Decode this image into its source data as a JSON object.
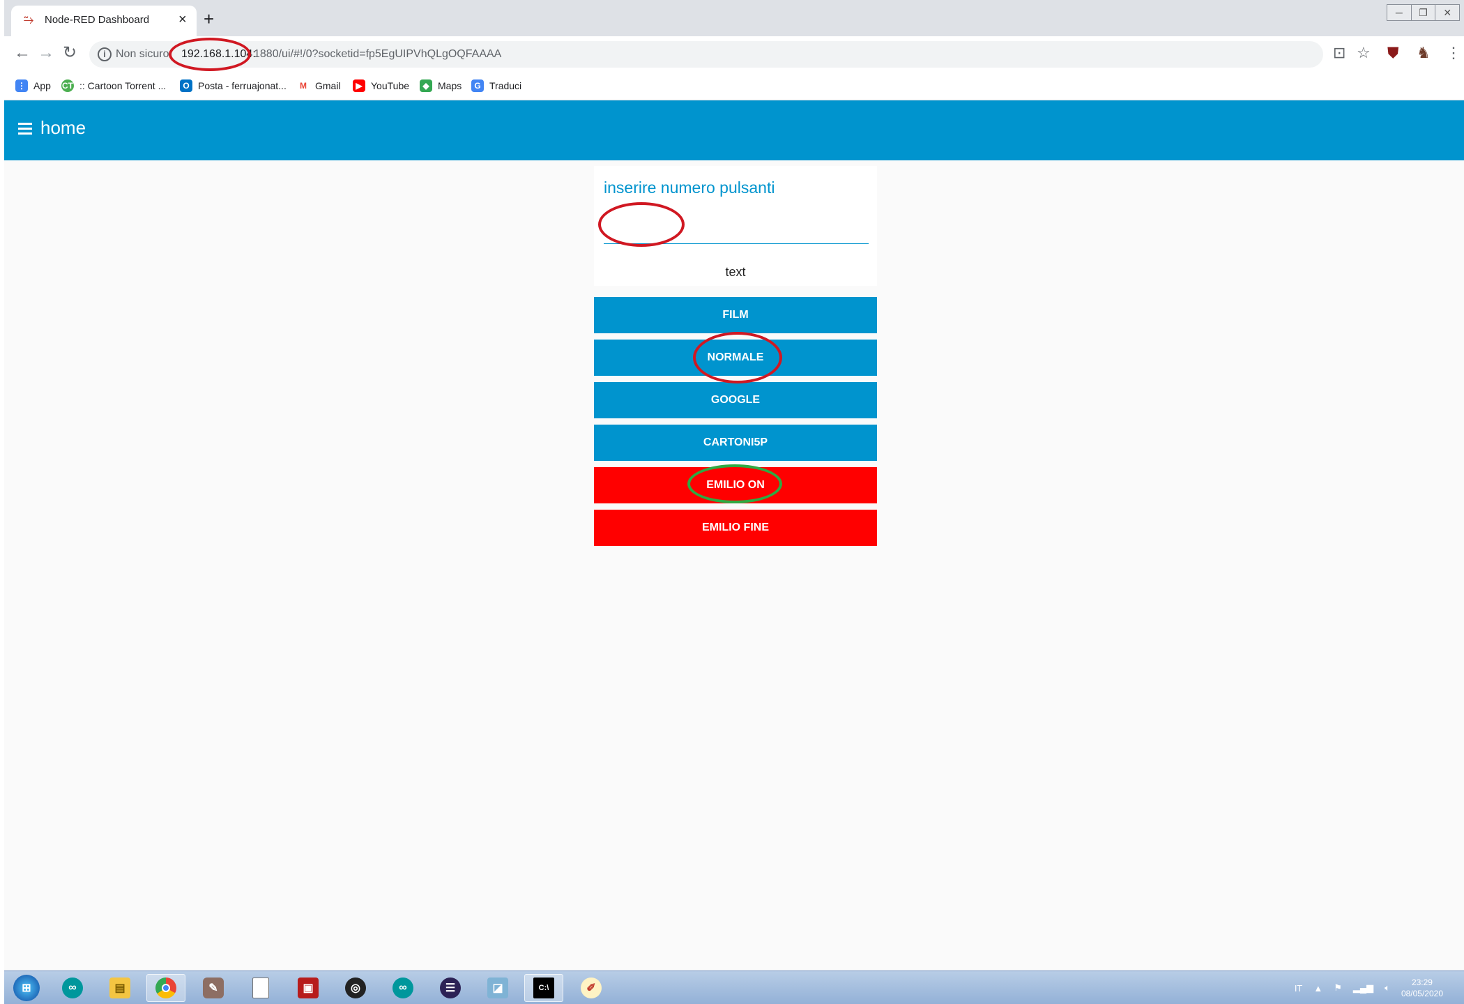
{
  "browser": {
    "tab_title": "Node-RED Dashboard",
    "tab_close": "×",
    "new_tab": "+",
    "security_label": "Non sicuro",
    "url_host": "192.168.1.104:",
    "url_rest": "1880/ui/#!/0?socketid=fp5EgUIPVhQLgOQFAAAA",
    "window_controls": [
      "─",
      "❐",
      "✕"
    ]
  },
  "bookmarks": [
    {
      "label": "App",
      "icon": "apps-grid-icon",
      "color": "#4285f4"
    },
    {
      "label": ":: Cartoon Torrent ...",
      "icon": "cartoon-torrent-icon",
      "color": "#4caf50"
    },
    {
      "label": "Posta - ferruajonat...",
      "icon": "outlook-icon",
      "color": "#0072c6"
    },
    {
      "label": "Gmail",
      "icon": "gmail-icon",
      "color": "#ea4335"
    },
    {
      "label": "YouTube",
      "icon": "youtube-icon",
      "color": "#ff0000"
    },
    {
      "label": "Maps",
      "icon": "maps-icon",
      "color": "#34a853"
    },
    {
      "label": "Traduci",
      "icon": "translate-icon",
      "color": "#4285f4"
    }
  ],
  "app": {
    "title": "home",
    "accent": "#0094ce"
  },
  "form": {
    "label": "inserire numero pulsanti",
    "input_value": "",
    "text_output": "text"
  },
  "buttons": [
    {
      "label": "FILM",
      "color": "#0094ce"
    },
    {
      "label": "NORMALE",
      "color": "#0094ce"
    },
    {
      "label": "GOOGLE",
      "color": "#0094ce"
    },
    {
      "label": "CARTONI5P",
      "color": "#0094ce"
    },
    {
      "label": "EMILIO ON",
      "color": "#ff0000"
    },
    {
      "label": "EMILIO FINE",
      "color": "#ff0000"
    }
  ],
  "annotations": {
    "red": "#d01822",
    "green": "#2eaa43"
  },
  "taskbar": {
    "language": "IT",
    "time": "23:29",
    "date": "08/05/2020",
    "apps": [
      "start-orb-icon",
      "arduino-icon",
      "file-explorer-icon",
      "chrome-icon",
      "gimp-icon",
      "blank-document-icon",
      "node-red-icon",
      "obs-icon",
      "arduino-icon-2",
      "eclipse-icon",
      "notepad-icon",
      "command-prompt-icon",
      "paint-icon"
    ]
  }
}
